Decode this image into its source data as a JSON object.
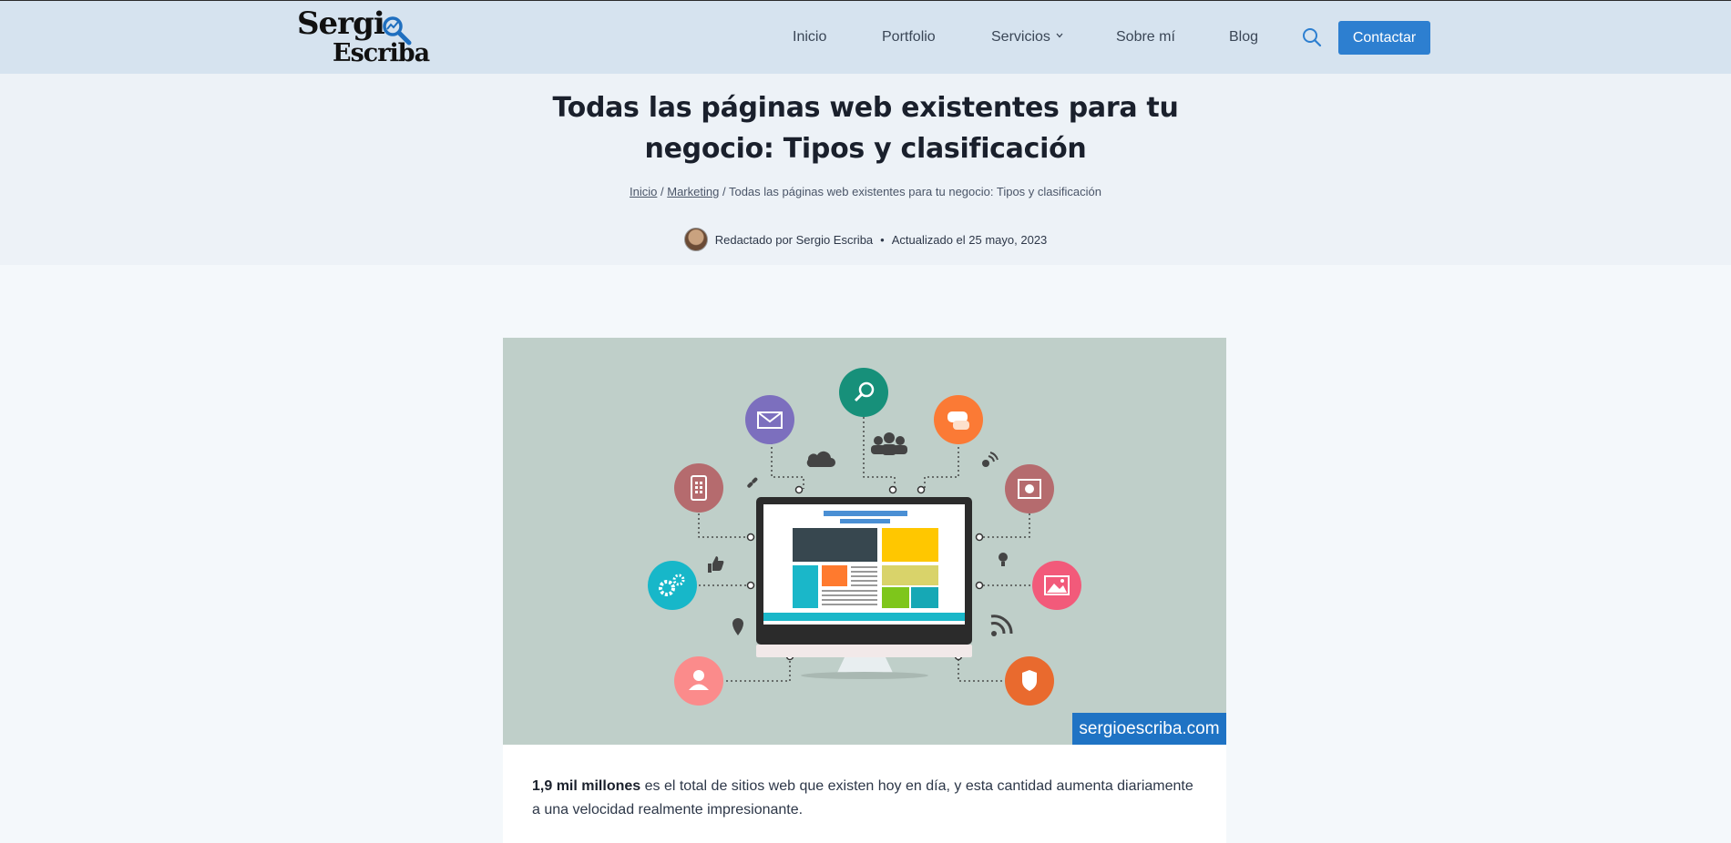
{
  "header": {
    "logo_line1": "Sergi",
    "logo_line2": "Escriba",
    "nav": [
      {
        "label": "Inicio"
      },
      {
        "label": "Portfolio"
      },
      {
        "label": "Servicios"
      },
      {
        "label": "Sobre mí"
      },
      {
        "label": "Blog"
      }
    ],
    "contact_label": "Contactar",
    "accent_color": "#2d7fd0"
  },
  "article": {
    "title": "Todas las páginas web existentes para tu negocio: Tipos y clasificación",
    "breadcrumb": {
      "home": "Inicio",
      "sep": "/",
      "category": "Marketing",
      "current": "Todas las páginas web existentes para tu negocio: Tipos y clasificación"
    },
    "byline": {
      "author": "Redactado por Sergio Escriba",
      "bullet": "•",
      "updated": "Actualizado el 25 mayo, 2023"
    },
    "hero_watermark": "sergioescriba.com",
    "intro_bold": "1,9 mil millones",
    "intro_rest": "es el total de sitios web que existen hoy en día, y esta cantidad aumenta diariamente a una velocidad realmente impresionante."
  },
  "hero_icons": [
    "mail-icon",
    "search-icon",
    "chat-icon",
    "mobile-icon",
    "video-icon",
    "gear-icon",
    "image-icon",
    "user-icon",
    "shield-icon",
    "cloud-icon",
    "group-icon",
    "satellite-icon",
    "link-icon",
    "thumb-up-icon",
    "lightbulb-icon",
    "location-pin-icon",
    "rss-icon",
    "monitor-icon"
  ]
}
